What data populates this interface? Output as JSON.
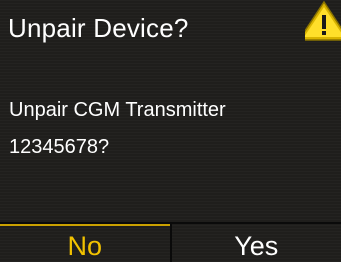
{
  "dialog": {
    "title": "Unpair Device?",
    "icon": "warning-triangle-icon",
    "message_line1": "Unpair CGM Transmitter",
    "message_line2": "12345678?"
  },
  "softkeys": {
    "left_label": "No",
    "right_label": "Yes",
    "selected": "left"
  },
  "colors": {
    "background": "#1f1e1c",
    "text": "#ffffff",
    "highlight": "#f2c200",
    "warning_fill": "#e6c200"
  }
}
